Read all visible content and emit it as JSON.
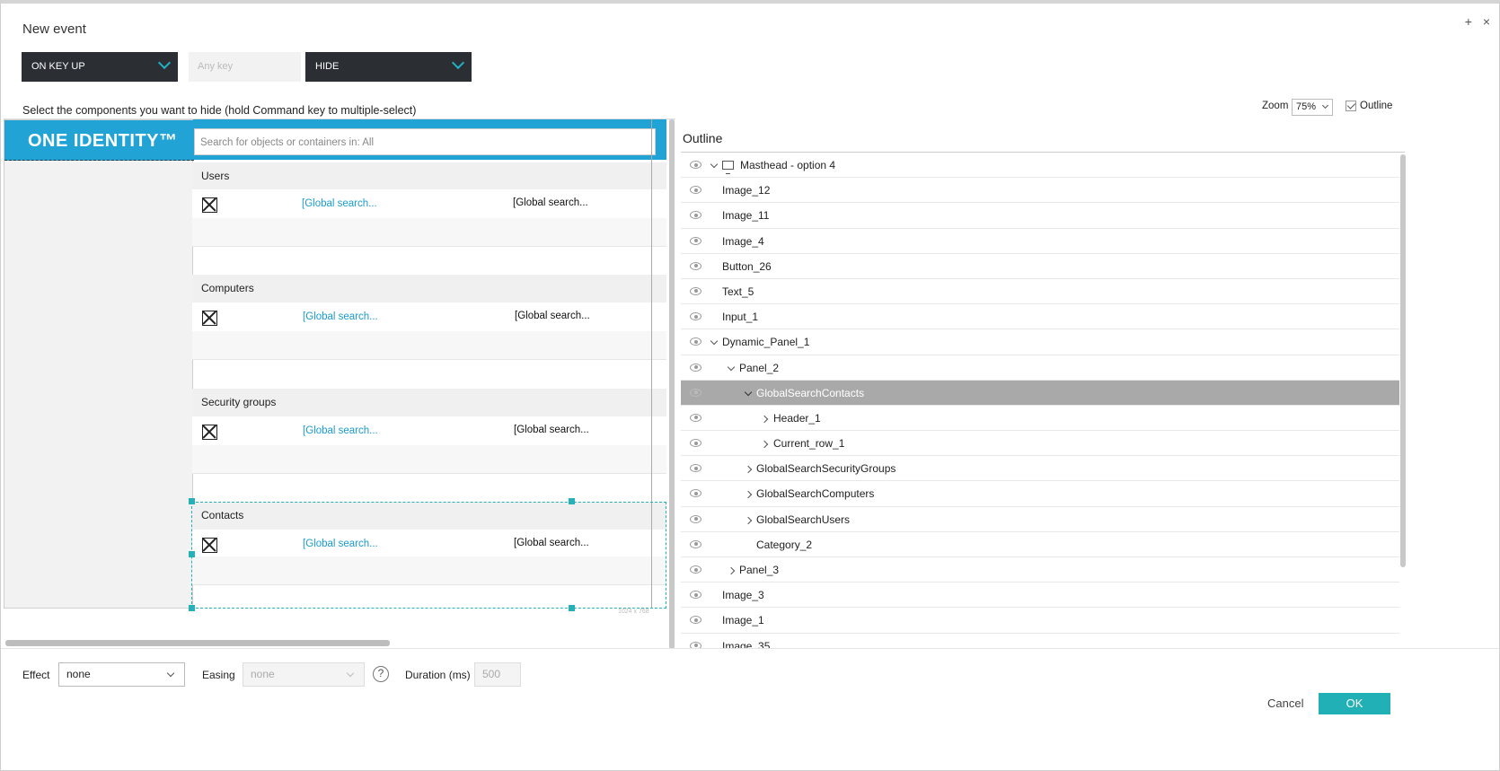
{
  "dialog": {
    "title": "New event",
    "add_symbol": "+",
    "close_symbol": "×"
  },
  "event": {
    "trigger": "ON KEY UP",
    "key_placeholder": "Any key",
    "action": "HIDE"
  },
  "instruction": "Select the components you want to hide (hold Command key to multiple-select)",
  "view": {
    "zoom_label": "Zoom",
    "zoom_value": "75%",
    "outline_label": "Outline",
    "outline_checked": true
  },
  "preview": {
    "logo_text": "ONE IDENTITY™",
    "search_placeholder": "Search for objects or containers in: All",
    "sections": [
      {
        "title": "Users",
        "link": "[Global search...",
        "value": "[Global search..."
      },
      {
        "title": "Computers",
        "link": "[Global search...",
        "value": "[Global search..."
      },
      {
        "title": "Security groups",
        "link": "[Global search...",
        "value": "[Global search..."
      },
      {
        "title": "Contacts",
        "link": "[Global search...",
        "value": "[Global search..."
      }
    ],
    "dimension_label": "1024 x 768",
    "brand_color": "#21a3d6"
  },
  "outline": {
    "title": "Outline",
    "items": [
      {
        "label": "Masthead - option 4",
        "level": 0,
        "toggle": "open",
        "icon": "monitor-icon"
      },
      {
        "label": "Image_12",
        "level": 0,
        "toggle": "none"
      },
      {
        "label": "Image_11",
        "level": 0,
        "toggle": "none"
      },
      {
        "label": "Image_4",
        "level": 0,
        "toggle": "none"
      },
      {
        "label": "Button_26",
        "level": 0,
        "toggle": "none"
      },
      {
        "label": "Text_5",
        "level": 0,
        "toggle": "none"
      },
      {
        "label": "Input_1",
        "level": 0,
        "toggle": "none"
      },
      {
        "label": "Dynamic_Panel_1",
        "level": 0,
        "toggle": "open"
      },
      {
        "label": "Panel_2",
        "level": 1,
        "toggle": "open"
      },
      {
        "label": "GlobalSearchContacts",
        "level": 2,
        "toggle": "open",
        "selected": true
      },
      {
        "label": "Header_1",
        "level": 3,
        "toggle": "closed"
      },
      {
        "label": "Current_row_1",
        "level": 3,
        "toggle": "closed"
      },
      {
        "label": "GlobalSearchSecurityGroups",
        "level": 2,
        "toggle": "closed"
      },
      {
        "label": "GlobalSearchComputers",
        "level": 2,
        "toggle": "closed"
      },
      {
        "label": "GlobalSearchUsers",
        "level": 2,
        "toggle": "closed"
      },
      {
        "label": "Category_2",
        "level": 2,
        "toggle": "none"
      },
      {
        "label": "Panel_3",
        "level": 1,
        "toggle": "closed"
      },
      {
        "label": "Image_3",
        "level": 0,
        "toggle": "none"
      },
      {
        "label": "Image_1",
        "level": 0,
        "toggle": "none"
      },
      {
        "label": "Image_35",
        "level": 0,
        "toggle": "none"
      }
    ]
  },
  "animation": {
    "effect_label": "Effect",
    "effect_value": "none",
    "easing_label": "Easing",
    "easing_value": "none",
    "help_symbol": "?",
    "duration_label": "Duration (ms)",
    "duration_value": "500"
  },
  "footer": {
    "cancel_label": "Cancel",
    "ok_label": "OK",
    "ok_color": "#21b0b6"
  }
}
